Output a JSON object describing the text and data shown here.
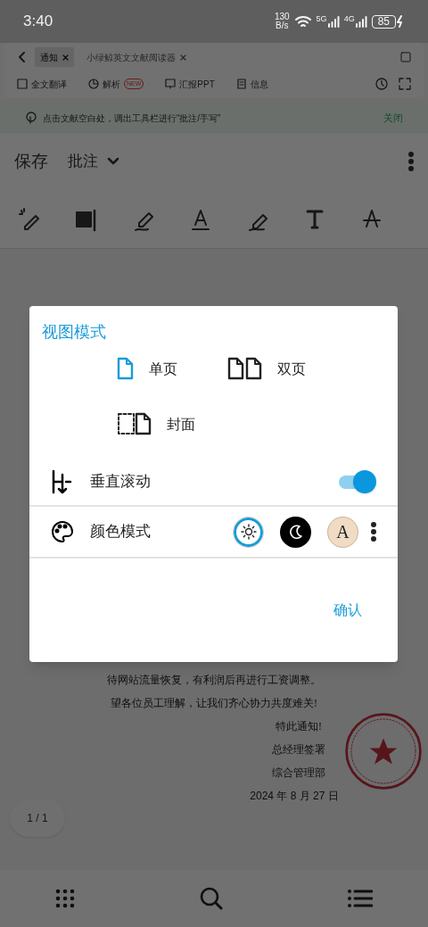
{
  "status_bar": {
    "time": "3:40",
    "speed": [
      "130",
      "B/s"
    ],
    "networks": [
      "5G",
      "4G"
    ],
    "battery": "85"
  },
  "tabs": [
    {
      "label": "通知",
      "selected": true
    },
    {
      "label": "小绿鲸英文文献阅读器",
      "selected": false
    }
  ],
  "doc_tools": [
    {
      "label": "全文翻译"
    },
    {
      "label": "解析",
      "badge": "NEW"
    },
    {
      "label": "汇报PPT"
    },
    {
      "label": "信息"
    }
  ],
  "notice": {
    "text": "点击文献空白处，调出工具栏进行“批注/手写”",
    "action": "关闭"
  },
  "toolbar": {
    "save": "保存",
    "mode": "批注"
  },
  "document": {
    "lines": [
      "待网站流量恢复，有利润后再进行工资调整。",
      "望各位员工理解，让我们齐心协力共度难关!",
      "特此通知!",
      "总经理签署",
      "综合管理部",
      "2024 年 8 月 27 日"
    ]
  },
  "page_indicator": "1 / 1",
  "dialog": {
    "title": "视图模式",
    "layouts": [
      {
        "kind": "single",
        "label": "单页",
        "selected": true
      },
      {
        "kind": "double",
        "label": "双页",
        "selected": false
      },
      {
        "kind": "cover",
        "label": "封面",
        "selected": false
      }
    ],
    "scroll": {
      "label": "垂直滚动",
      "on": true
    },
    "color_mode": {
      "label": "颜色模式",
      "options": [
        {
          "kind": "light",
          "selected": true
        },
        {
          "kind": "dark",
          "selected": false
        },
        {
          "kind": "sepia",
          "label": "A",
          "selected": false
        }
      ]
    },
    "confirm": "确认"
  }
}
